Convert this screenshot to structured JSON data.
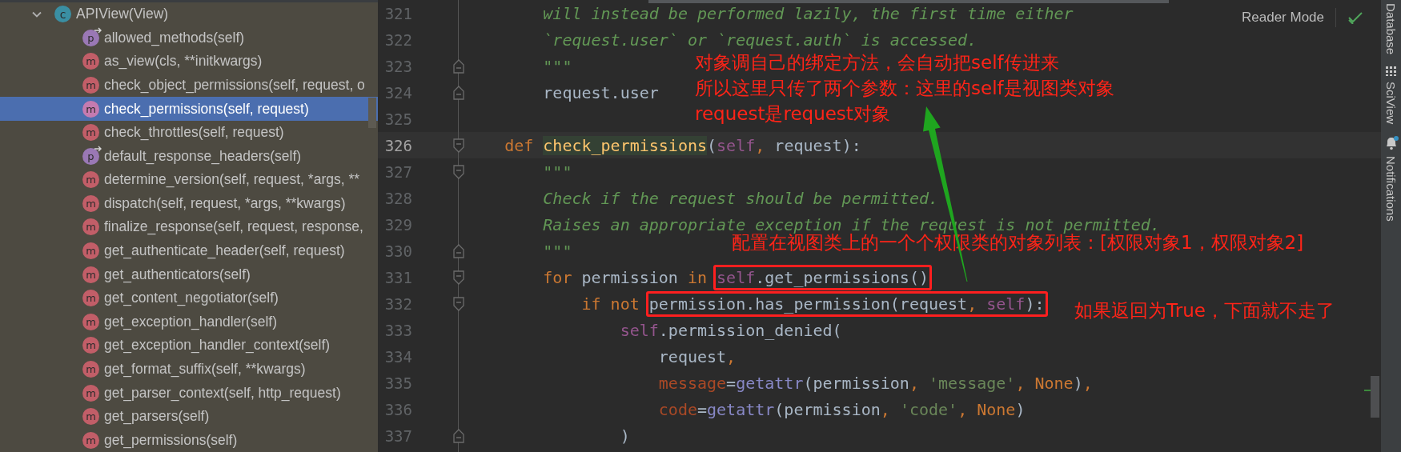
{
  "structure_panel": {
    "items": [
      {
        "label": "APIView(View)",
        "kind": "class",
        "icon_letter": "c",
        "expanded": true,
        "selected": false,
        "children": [
          {
            "label": "allowed_methods(self)",
            "kind": "property",
            "icon_letter": "p",
            "selected": false
          },
          {
            "label": "as_view(cls, **initkwargs)",
            "kind": "method",
            "icon_letter": "m",
            "selected": false
          },
          {
            "label": "check_object_permissions(self, request, o",
            "kind": "method",
            "icon_letter": "m",
            "selected": false
          },
          {
            "label": "check_permissions(self, request)",
            "kind": "method",
            "icon_letter": "m",
            "selected": true
          },
          {
            "label": "check_throttles(self, request)",
            "kind": "method",
            "icon_letter": "m",
            "selected": false
          },
          {
            "label": "default_response_headers(self)",
            "kind": "property",
            "icon_letter": "p",
            "selected": false
          },
          {
            "label": "determine_version(self, request, *args, **",
            "kind": "method",
            "icon_letter": "m",
            "selected": false
          },
          {
            "label": "dispatch(self, request, *args, **kwargs)",
            "kind": "method",
            "icon_letter": "m",
            "selected": false
          },
          {
            "label": "finalize_response(self, request, response,",
            "kind": "method",
            "icon_letter": "m",
            "selected": false
          },
          {
            "label": "get_authenticate_header(self, request)",
            "kind": "method",
            "icon_letter": "m",
            "selected": false
          },
          {
            "label": "get_authenticators(self)",
            "kind": "method",
            "icon_letter": "m",
            "selected": false
          },
          {
            "label": "get_content_negotiator(self)",
            "kind": "method",
            "icon_letter": "m",
            "selected": false
          },
          {
            "label": "get_exception_handler(self)",
            "kind": "method",
            "icon_letter": "m",
            "selected": false
          },
          {
            "label": "get_exception_handler_context(self)",
            "kind": "method",
            "icon_letter": "m",
            "selected": false
          },
          {
            "label": "get_format_suffix(self, **kwargs)",
            "kind": "method",
            "icon_letter": "m",
            "selected": false
          },
          {
            "label": "get_parser_context(self, http_request)",
            "kind": "method",
            "icon_letter": "m",
            "selected": false
          },
          {
            "label": "get_parsers(self)",
            "kind": "method",
            "icon_letter": "m",
            "selected": false
          },
          {
            "label": "get_permissions(self)",
            "kind": "method",
            "icon_letter": "m",
            "selected": false
          }
        ]
      }
    ]
  },
  "editor": {
    "lines": [
      {
        "number": "321",
        "selected": false,
        "kind": "code",
        "tokens": [
          {
            "kind": "doc",
            "text": "        will instead be performed lazily, the first time either"
          }
        ]
      },
      {
        "number": "322",
        "selected": false,
        "kind": "code",
        "tokens": [
          {
            "kind": "doc",
            "text": "        `request.user` or `request.auth` is accessed."
          }
        ]
      },
      {
        "number": "323",
        "selected": false,
        "kind": "fold_end",
        "tokens": [
          {
            "kind": "doc",
            "text": "        \"\"\""
          }
        ]
      },
      {
        "number": "324",
        "selected": false,
        "kind": "fold_end",
        "tokens": [
          {
            "kind": "plain",
            "text": "        request.user"
          }
        ]
      },
      {
        "number": "325",
        "selected": false,
        "kind": "code"
      },
      {
        "number": "326",
        "selected": true,
        "kind": "fold_start",
        "tokens": [
          {
            "kind": "kw",
            "text": "    def "
          },
          {
            "kind": "fn",
            "text": "check_permissions"
          },
          {
            "kind": "plain",
            "text": "("
          },
          {
            "kind": "self",
            "text": "self"
          },
          {
            "kind": "kw",
            "text": ", "
          },
          {
            "kind": "plain",
            "text": "request):"
          }
        ]
      },
      {
        "number": "327",
        "selected": false,
        "kind": "fold_start",
        "tokens": [
          {
            "kind": "doc",
            "text": "        \"\"\""
          }
        ]
      },
      {
        "number": "328",
        "selected": false,
        "kind": "code",
        "tokens": [
          {
            "kind": "doc",
            "text": "        Check if the request should be permitted."
          }
        ]
      },
      {
        "number": "329",
        "selected": false,
        "kind": "code",
        "tokens": [
          {
            "kind": "doc",
            "text": "        Raises an appropriate exception if the request is not permitted."
          }
        ]
      },
      {
        "number": "330",
        "selected": false,
        "kind": "fold_end",
        "tokens": [
          {
            "kind": "doc",
            "text": "        \"\"\""
          }
        ]
      },
      {
        "number": "331",
        "selected": false,
        "kind": "fold_start",
        "tokens": [
          {
            "kind": "kw",
            "text": "        for"
          },
          {
            "kind": "plain",
            "text": " permission "
          },
          {
            "kind": "kw",
            "text": "in "
          },
          {
            "kind": "box",
            "tokens": [
              {
                "kind": "self",
                "text": "self"
              },
              {
                "kind": "plain",
                "text": ".get_permissions()"
              }
            ]
          }
        ]
      },
      {
        "number": "332",
        "selected": false,
        "kind": "fold_start",
        "tokens": [
          {
            "kind": "kw",
            "text": "            if not "
          },
          {
            "kind": "box",
            "tokens": [
              {
                "kind": "plain",
                "text": "permission.has_permission(request"
              },
              {
                "kind": "kw",
                "text": ", "
              },
              {
                "kind": "self",
                "text": "self"
              },
              {
                "kind": "plain",
                "text": "):"
              }
            ]
          }
        ]
      },
      {
        "number": "333",
        "selected": false,
        "kind": "code",
        "tokens": [
          {
            "kind": "self",
            "text": "                self"
          },
          {
            "kind": "plain",
            "text": ".permission_denied("
          }
        ]
      },
      {
        "number": "334",
        "selected": false,
        "kind": "code",
        "tokens": [
          {
            "kind": "plain",
            "text": "                    request"
          },
          {
            "kind": "kw",
            "text": ","
          }
        ]
      },
      {
        "number": "335",
        "selected": false,
        "kind": "code",
        "tokens": [
          {
            "kind": "param",
            "text": "                    message"
          },
          {
            "kind": "plain",
            "text": "="
          },
          {
            "kind": "builtin",
            "text": "getattr"
          },
          {
            "kind": "plain",
            "text": "(permission"
          },
          {
            "kind": "kw",
            "text": ", "
          },
          {
            "kind": "str",
            "text": "'message'"
          },
          {
            "kind": "kw",
            "text": ", None"
          },
          {
            "kind": "plain",
            "text": ")"
          },
          {
            "kind": "kw",
            "text": ","
          }
        ]
      },
      {
        "number": "336",
        "selected": false,
        "kind": "code",
        "tokens": [
          {
            "kind": "param",
            "text": "                    code"
          },
          {
            "kind": "plain",
            "text": "="
          },
          {
            "kind": "builtin",
            "text": "getattr"
          },
          {
            "kind": "plain",
            "text": "(permission"
          },
          {
            "kind": "kw",
            "text": ", "
          },
          {
            "kind": "str",
            "text": "'code'"
          },
          {
            "kind": "kw",
            "text": ", None"
          },
          {
            "kind": "plain",
            "text": ")"
          }
        ]
      },
      {
        "number": "337",
        "selected": false,
        "kind": "fold_end",
        "tokens": [
          {
            "kind": "plain",
            "text": "                )"
          }
        ]
      }
    ],
    "reader_mode": "Reader Mode"
  },
  "annotations": [
    {
      "lines": [
        "对象调自己的绑定方法，会自动把self传进来",
        "所以这里只传了两个参数：这里的self是视图类对象",
        "request是request对象"
      ]
    },
    {
      "lines": [
        "配置在视图类上的一个个权限类的对象列表：[权限对象1，权限对象2]"
      ]
    },
    {
      "lines": [
        "如果返回为True，下面就不走了"
      ]
    }
  ],
  "tool_window_bar": [
    {
      "label": "Database"
    },
    {
      "label": "SciView"
    },
    {
      "label": "Notifications"
    }
  ]
}
